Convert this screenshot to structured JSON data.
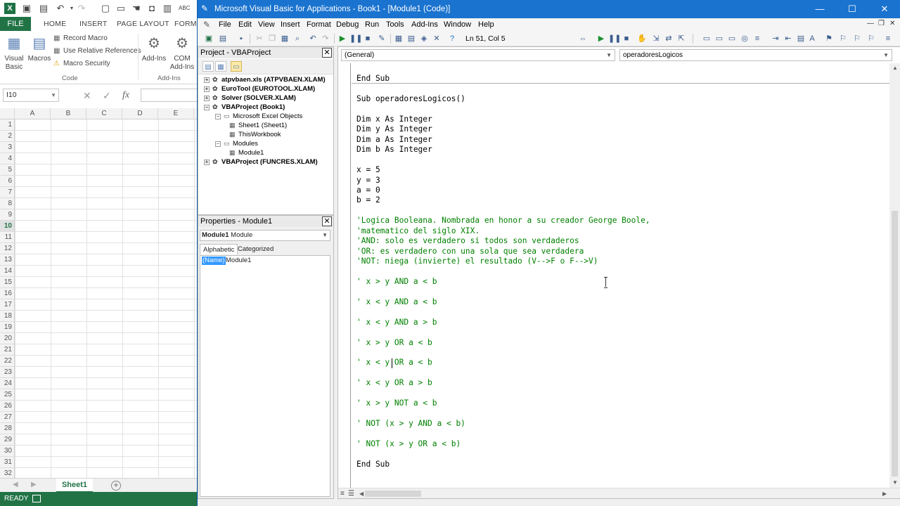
{
  "excel": {
    "logo": "X",
    "tabs": {
      "file": "FILE",
      "home": "HOME",
      "insert": "INSERT",
      "page_layout": "PAGE LAYOUT",
      "formulas": "FORMU"
    },
    "ribbon": {
      "visual_basic": [
        "Visual",
        "Basic"
      ],
      "macros": "Macros",
      "record_macro": "Record Macro",
      "relative_refs": "Use Relative References",
      "macro_security": "Macro Security",
      "group_code": "Code",
      "add_ins": "Add-Ins",
      "com_add_ins": [
        "COM",
        "Add-Ins"
      ],
      "group_add_ins": "Add-Ins"
    },
    "name_box": "I10",
    "fx": "fx",
    "columns": [
      "A",
      "B",
      "C",
      "D",
      "E"
    ],
    "rows": [
      "1",
      "2",
      "3",
      "4",
      "5",
      "6",
      "7",
      "8",
      "9",
      "10",
      "11",
      "12",
      "13",
      "14",
      "15",
      "16",
      "17",
      "18",
      "19",
      "20",
      "21",
      "22",
      "23",
      "24",
      "25",
      "26",
      "27",
      "28",
      "29",
      "30",
      "31",
      "32"
    ],
    "selected_row": "10",
    "sheet_tab": "Sheet1",
    "add_sheet": "+",
    "status": "READY"
  },
  "vba": {
    "title": "Microsoft Visual Basic for Applications - Book1 - [Module1 (Code)]",
    "menu": [
      "File",
      "Edit",
      "View",
      "Insert",
      "Format",
      "Debug",
      "Run",
      "Tools",
      "Add-Ins",
      "Window",
      "Help"
    ],
    "cursor_pos": "Ln 51, Col 5",
    "project_pane": {
      "title": "Project - VBAProject",
      "tree": [
        {
          "label": "atpvbaen.xls (ATPVBAEN.XLAM)",
          "level": 0,
          "exp": "+",
          "bold": true
        },
        {
          "label": "EuroTool (EUROTOOL.XLAM)",
          "level": 0,
          "exp": "+",
          "bold": true
        },
        {
          "label": "Solver (SOLVER.XLAM)",
          "level": 0,
          "exp": "+",
          "bold": true
        },
        {
          "label": "VBAProject (Book1)",
          "level": 0,
          "exp": "−",
          "bold": true
        },
        {
          "label": "Microsoft Excel Objects",
          "level": 1,
          "exp": "−",
          "bold": false
        },
        {
          "label": "Sheet1 (Sheet1)",
          "level": 2,
          "exp": "",
          "bold": false
        },
        {
          "label": "ThisWorkbook",
          "level": 2,
          "exp": "",
          "bold": false
        },
        {
          "label": "Modules",
          "level": 1,
          "exp": "−",
          "bold": false
        },
        {
          "label": "Module1",
          "level": 2,
          "exp": "",
          "bold": false
        },
        {
          "label": "VBAProject (FUNCRES.XLAM)",
          "level": 0,
          "exp": "+",
          "bold": true
        }
      ]
    },
    "properties_pane": {
      "title": "Properties - Module1",
      "object_name": "Module1",
      "object_type": "Module",
      "tab_alphabetic": "Alphabetic",
      "tab_categorized": "Categorized",
      "prop_name": "(Name)",
      "prop_value": "Module1"
    },
    "code": {
      "object_combo": "(General)",
      "proc_combo": "operadoresLogicos",
      "lines": [
        {
          "text": "End Sub",
          "type": "kw"
        },
        {
          "text": "Sub operadoresLogicos()",
          "type": "kw"
        },
        {
          "text": "Dim x As Integer",
          "type": "kw"
        },
        {
          "text": "Dim y As Integer",
          "type": "kw"
        },
        {
          "text": "Dim a As Integer",
          "type": "kw"
        },
        {
          "text": "Dim b As Integer",
          "type": "kw"
        },
        {
          "text": "x = 5",
          "type": "code"
        },
        {
          "text": "y = 3",
          "type": "code"
        },
        {
          "text": "a = 0",
          "type": "code"
        },
        {
          "text": "b = 2",
          "type": "code"
        },
        {
          "text": "'Logica Booleana. Nombrada en honor a su creador George Boole,",
          "type": "comment"
        },
        {
          "text": "'matematico del siglo XIX.",
          "type": "comment"
        },
        {
          "text": "'AND: solo es verdadero si todos son verdaderos",
          "type": "comment"
        },
        {
          "text": "'OR: es verdadero con una sola que sea verdadera",
          "type": "comment"
        },
        {
          "text": "'NOT: niega (invierte) el resultado (V-->F o F-->V)",
          "type": "comment"
        },
        {
          "text": "' x > y AND a < b",
          "type": "comment"
        },
        {
          "text": "' x < y AND a < b",
          "type": "comment"
        },
        {
          "text": "' x < y AND a > b",
          "type": "comment"
        },
        {
          "text": "' x > y OR a < b",
          "type": "comment"
        },
        {
          "text": "' x < y OR a < b",
          "type": "comment"
        },
        {
          "text": "' x < y OR a > b",
          "type": "comment"
        },
        {
          "text": "' x > y NOT a < b",
          "type": "comment"
        },
        {
          "text": "' NOT (x > y AND a < b)",
          "type": "comment"
        },
        {
          "text": "' NOT (x > y OR a < b)",
          "type": "comment"
        },
        {
          "text": "End Sub",
          "type": "kw"
        }
      ]
    }
  },
  "colors": {
    "excel_green": "#217346",
    "vba_title_blue": "#1a73cf",
    "comment_green": "#008000",
    "selection_blue": "#3399ff"
  }
}
